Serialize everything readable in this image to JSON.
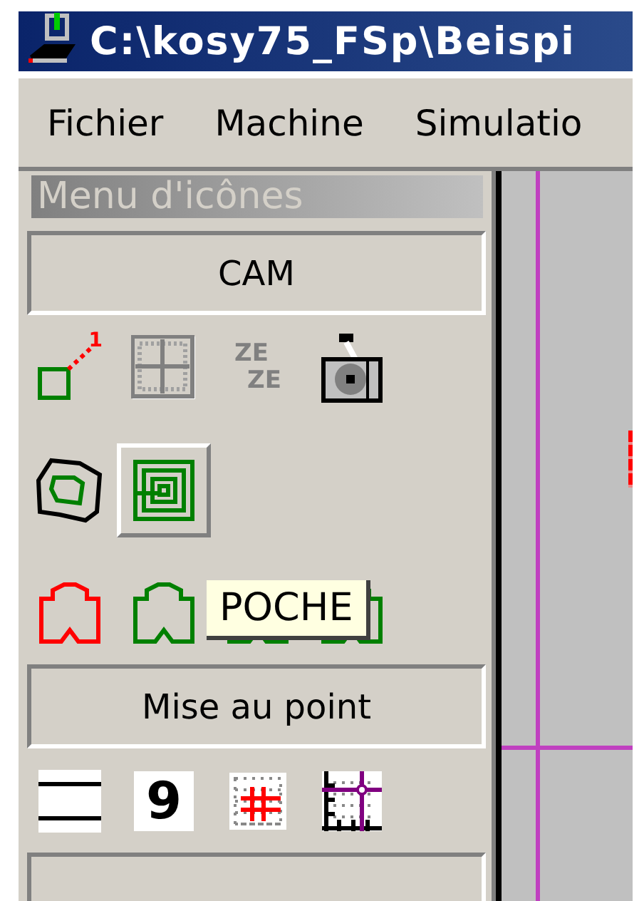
{
  "window": {
    "title": "C:\\kosy75_FSp\\Beispi"
  },
  "menu": [
    "Fichier",
    "Machine",
    "Simulatio"
  ],
  "panel": {
    "title": "Menu d'icônes",
    "sections": [
      {
        "label": "CAM",
        "rows": [
          [
            {
              "kind": "chamfer",
              "text": "1",
              "selected": false
            },
            {
              "kind": "grid",
              "selected": false
            },
            {
              "kind": "letters",
              "lines": [
                "ZE",
                "ZE"
              ],
              "selected": false
            },
            {
              "kind": "camera",
              "selected": false
            }
          ],
          [
            {
              "kind": "contour",
              "selected": false
            },
            {
              "kind": "spiral",
              "selected": true
            }
          ],
          [
            {
              "kind": "profile",
              "color": "#ff0000",
              "selected": false
            },
            {
              "kind": "profile",
              "color": "#008000",
              "selected": false
            },
            {
              "kind": "profile",
              "color": "#008000",
              "selected": false
            },
            {
              "kind": "profile",
              "color": "#008000",
              "selected": false
            }
          ]
        ]
      },
      {
        "label": "Mise au point",
        "rows": [
          [
            {
              "kind": "lines",
              "selected": false
            },
            {
              "kind": "digit",
              "text": "9",
              "selected": false
            },
            {
              "kind": "target",
              "selected": false
            },
            {
              "kind": "axes",
              "selected": false
            }
          ]
        ]
      }
    ]
  },
  "tooltip": {
    "text": "POCHE"
  }
}
